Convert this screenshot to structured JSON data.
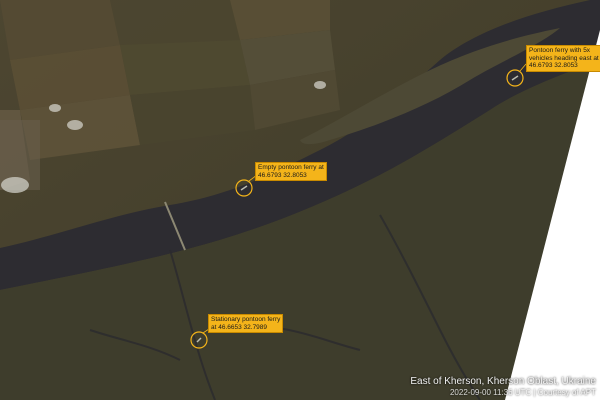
{
  "colors": {
    "annotation": "#f4b41a",
    "river": "#2d2c31",
    "land": "#4a4530"
  },
  "annotations": [
    {
      "lines": [
        "Pontoon ferry with 5x",
        "vehicles heading east at",
        "46.6793 32.8053"
      ]
    },
    {
      "lines": [
        "Empty pontoon ferry at",
        "46.6793 32.8053"
      ]
    },
    {
      "lines": [
        "Stationary pontoon ferry",
        "at 46.6653 32.7989"
      ]
    }
  ],
  "caption": {
    "location": "East of Kherson, Kherson Oblast, Ukraine",
    "credit": "2022-09-00 11:36 UTC | Courtesy of APT"
  }
}
